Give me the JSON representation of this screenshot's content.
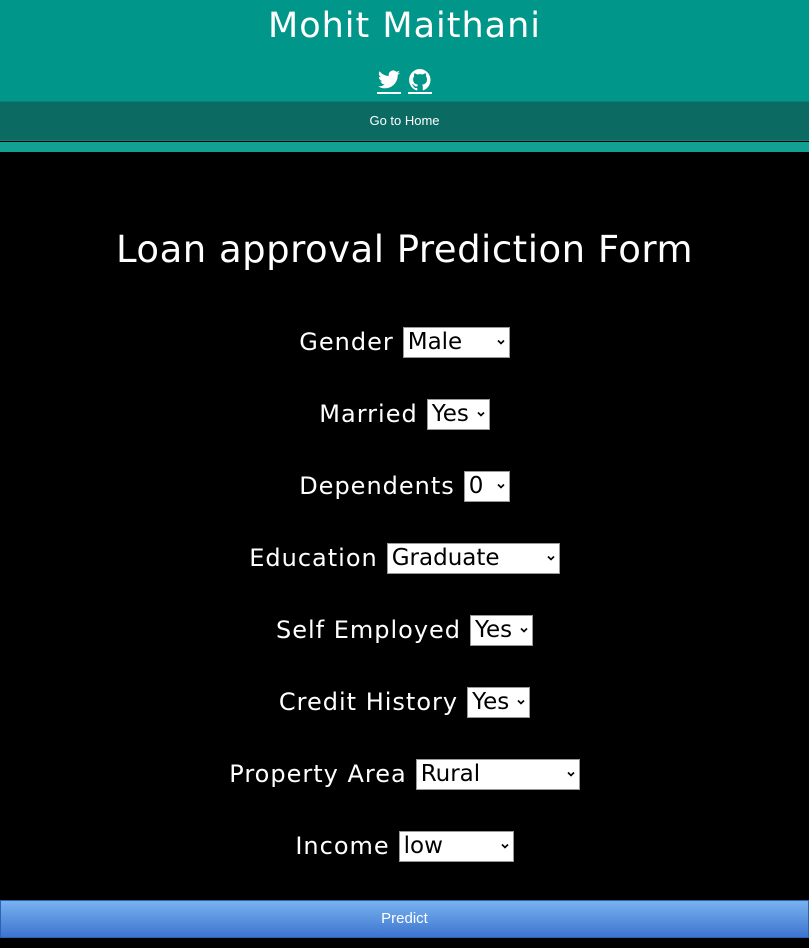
{
  "header": {
    "title": "Mohit Maithani",
    "social": [
      {
        "icon": "twitter-icon"
      },
      {
        "icon": "github-icon"
      }
    ]
  },
  "nav": {
    "home_label": "Go to Home"
  },
  "form": {
    "title": "Loan approval Prediction Form",
    "fields": {
      "gender": {
        "label": "Gender",
        "value": "Male"
      },
      "married": {
        "label": "Married",
        "value": "Yes"
      },
      "dependents": {
        "label": "Dependents",
        "value": "0"
      },
      "education": {
        "label": "Education",
        "value": "Graduate"
      },
      "self_employed": {
        "label": "Self Employed",
        "value": "Yes"
      },
      "credit_history": {
        "label": "Credit History",
        "value": "Yes"
      },
      "property_area": {
        "label": "Property Area",
        "value": "Rural"
      },
      "income": {
        "label": "Income",
        "value": "low"
      }
    },
    "submit_label": "Predict"
  },
  "colors": {
    "header_bg": "#00968a",
    "nav_bg": "#0b6a62",
    "page_bg": "#000000",
    "button_top": "#78b2ef",
    "button_bottom": "#3d75cf"
  }
}
